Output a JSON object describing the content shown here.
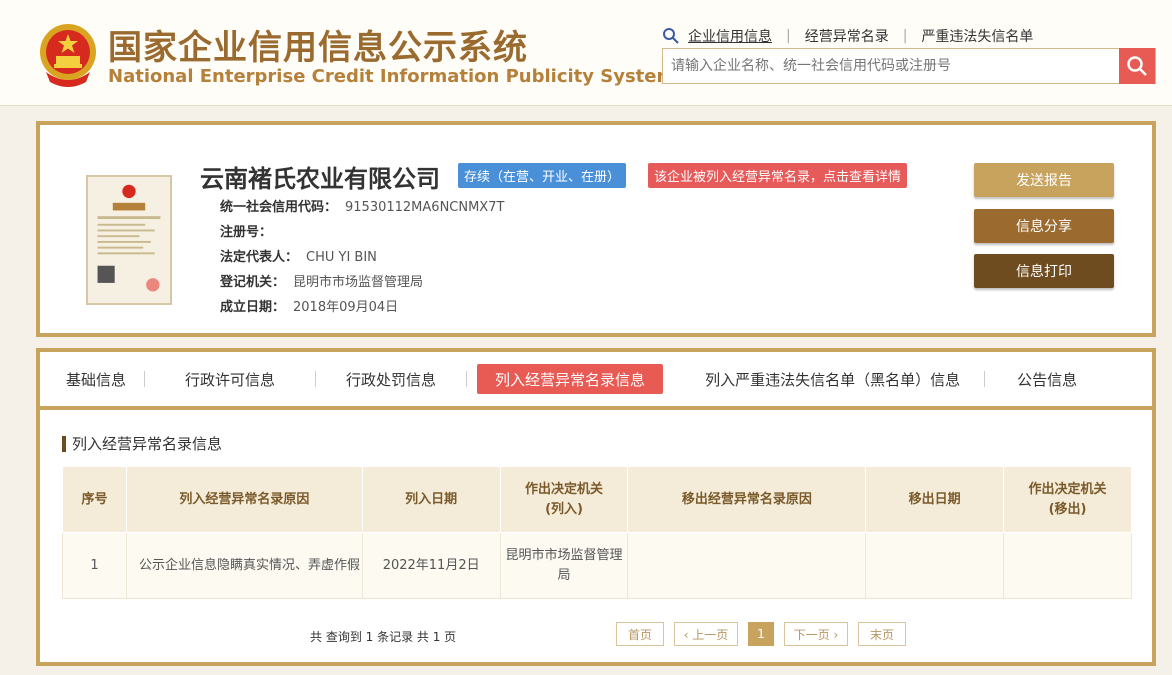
{
  "header": {
    "title_zh": "国家企业信用信息公示系统",
    "title_en": "National Enterprise Credit Information Publicity System",
    "nav": [
      "企业信用信息",
      "经营异常名录",
      "严重违法失信名单"
    ],
    "search_placeholder": "请输入企业名称、统一社会信用代码或注册号"
  },
  "company": {
    "name": "云南褚氏农业有限公司",
    "status": "存续（在营、开业、在册）",
    "abnormal_notice": "该企业被列入经营异常名录，点击查看详情",
    "fields": [
      {
        "label": "统一社会信用代码：",
        "value": "91530112MA6NCNMX7T"
      },
      {
        "label": "注册号：",
        "value": ""
      },
      {
        "label": "法定代表人：",
        "value": "CHU YI BIN"
      },
      {
        "label": "登记机关：",
        "value": "昆明市市场监督管理局"
      },
      {
        "label": "成立日期：",
        "value": "2018年09月04日"
      }
    ],
    "buttons": {
      "send": "发送报告",
      "share": "信息分享",
      "print": "信息打印"
    }
  },
  "tabs": [
    "基础信息",
    "行政许可信息",
    "行政处罚信息",
    "列入经营异常名录信息",
    "列入严重违法失信名单（黑名单）信息",
    "公告信息"
  ],
  "active_tab_index": 3,
  "section_title": "列入经营异常名录信息",
  "table": {
    "headers": [
      "序号",
      "列入经营异常名录原因",
      "列入日期",
      "作出决定机关\n(列入)",
      "移出经营异常名录原因",
      "移出日期",
      "作出决定机关\n(移出)"
    ],
    "rows": [
      [
        "1",
        "公示企业信息隐瞒真实情况、弄虚作假",
        "2022年11月2日",
        "昆明市市场监督管理局",
        "",
        "",
        ""
      ]
    ]
  },
  "pagination": {
    "summary": "共 查询到 1 条记录 共 1 页",
    "first": "首页",
    "prev": "‹ 上一页",
    "current": "1",
    "next": "下一页 ›",
    "last": "末页"
  },
  "colors": {
    "gold": "#c8a35e",
    "brown": "#9a6a2f",
    "dark_brown": "#6f4c1f",
    "red": "#e85a54",
    "blue": "#4a90d9"
  }
}
